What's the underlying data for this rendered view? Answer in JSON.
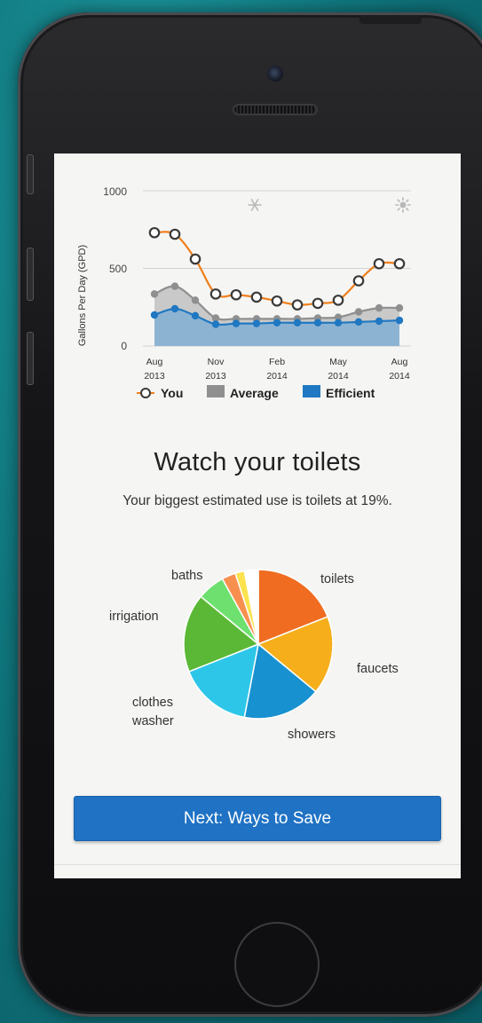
{
  "chart": {
    "y_axis_label": "Gallons Per Day (GPD)",
    "y_ticks": [
      "1000",
      "500",
      "0"
    ],
    "x_ticks": [
      {
        "month": "Aug",
        "year": "2013"
      },
      {
        "month": "Nov",
        "year": "2013"
      },
      {
        "month": "Feb",
        "year": "2014"
      },
      {
        "month": "May",
        "year": "2014"
      },
      {
        "month": "Aug",
        "year": "2014"
      }
    ],
    "legend": {
      "you": "You",
      "average": "Average",
      "efficient": "Efficient"
    },
    "colors": {
      "you": "#f07f1a",
      "average": "#8f8f8f",
      "efficient": "#1f78c1",
      "average_fill": "#c9c9c9",
      "efficient_fill": "#8db3d3"
    },
    "season_icons": [
      "snowflake-icon",
      "sun-icon"
    ]
  },
  "chart_data": {
    "type": "area",
    "ylabel": "Gallons Per Day (GPD)",
    "ylim": [
      0,
      1000
    ],
    "x": [
      "Aug 2013",
      "Sep 2013",
      "Oct 2013",
      "Nov 2013",
      "Dec 2013",
      "Jan 2014",
      "Feb 2014",
      "Mar 2014",
      "Apr 2014",
      "May 2014",
      "Jun 2014",
      "Jul 2014",
      "Aug 2014"
    ],
    "series": [
      {
        "name": "You",
        "values": [
          730,
          720,
          560,
          335,
          330,
          315,
          290,
          265,
          275,
          295,
          420,
          530,
          530
        ]
      },
      {
        "name": "Average",
        "values": [
          335,
          385,
          295,
          180,
          175,
          175,
          175,
          175,
          180,
          185,
          220,
          245,
          245
        ]
      },
      {
        "name": "Efficient",
        "values": [
          200,
          240,
          195,
          140,
          145,
          145,
          150,
          150,
          150,
          150,
          155,
          160,
          165
        ]
      }
    ],
    "grid": true,
    "legend_position": "bottom"
  },
  "content": {
    "headline": "Watch your toilets",
    "subline": "Your biggest estimated use is toilets at 19%."
  },
  "pie": {
    "type": "pie",
    "slices": [
      {
        "label": "toilets",
        "value": 19,
        "color": "#ef6c21"
      },
      {
        "label": "faucets",
        "value": 17,
        "color": "#f6ae1b"
      },
      {
        "label": "showers",
        "value": 17,
        "color": "#1891d0"
      },
      {
        "label": "clothes washer",
        "value": 16,
        "color": "#2ec6e8"
      },
      {
        "label": "irrigation",
        "value": 17,
        "color": "#5bb836"
      },
      {
        "label": "baths",
        "value": 6,
        "color": "#6ee06f"
      },
      {
        "label": "",
        "value": 3,
        "color": "#f7904f"
      },
      {
        "label": "",
        "value": 2,
        "color": "#fbe24e"
      },
      {
        "label": "",
        "value": 3,
        "color": "#ffffff"
      }
    ],
    "labels": {
      "toilets": "toilets",
      "faucets": "faucets",
      "showers": "showers",
      "clothes_1": "clothes",
      "clothes_2": "washer",
      "irrigation": "irrigation",
      "baths": "baths"
    }
  },
  "actions": {
    "next_label": "Next: Ways to Save"
  }
}
